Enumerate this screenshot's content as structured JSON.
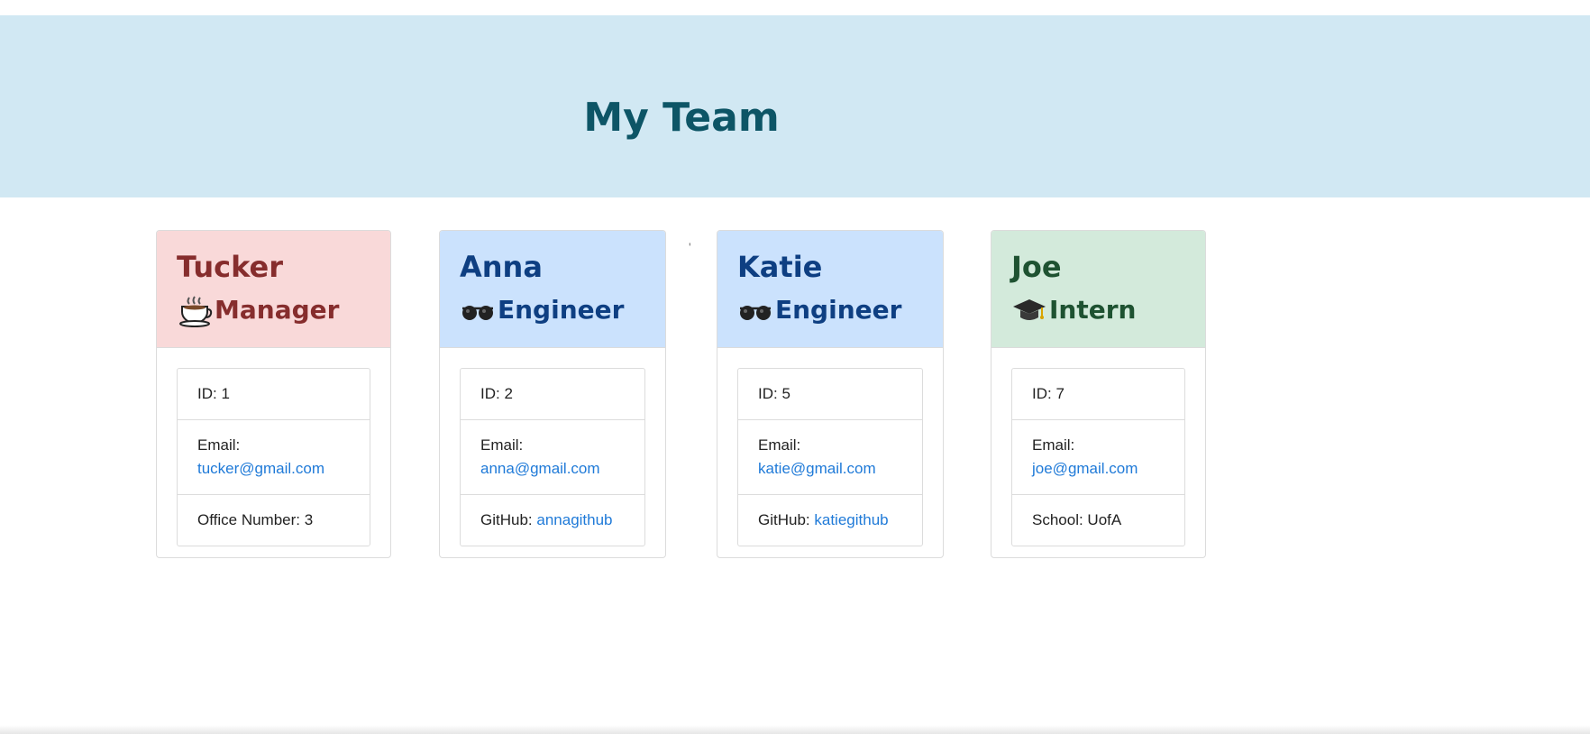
{
  "header": {
    "title": "My Team"
  },
  "team": [
    {
      "name": "Tucker",
      "role": "Manager",
      "icon": "coffee-icon",
      "id_label": "ID: 1",
      "email_label": "Email:",
      "email": "tucker@gmail.com",
      "extra_label": "Office Number: 3"
    },
    {
      "name": "Anna",
      "role": "Engineer",
      "icon": "glasses-icon",
      "id_label": "ID: 2",
      "email_label": "Email:",
      "email": "anna@gmail.com",
      "extra_label": "GitHub:",
      "extra_link": "annagithub"
    },
    {
      "name": "Katie",
      "role": "Engineer",
      "icon": "glasses-icon",
      "id_label": "ID: 5",
      "email_label": "Email:",
      "email": "katie@gmail.com",
      "extra_label": "GitHub:",
      "extra_link": "katiegithub"
    },
    {
      "name": "Joe",
      "role": "Intern",
      "icon": "graduation-cap-icon",
      "id_label": "ID: 7",
      "email_label": "Email:",
      "email": "joe@gmail.com",
      "extra_label": "School: UofA"
    }
  ],
  "stray_mark": "'",
  "colors": {
    "header_bg": "#d1e8f3",
    "manager_bg": "#f9d9d9",
    "engineer_bg": "#cbe2fd",
    "intern_bg": "#d3eadb",
    "link": "#1f7ad8"
  }
}
